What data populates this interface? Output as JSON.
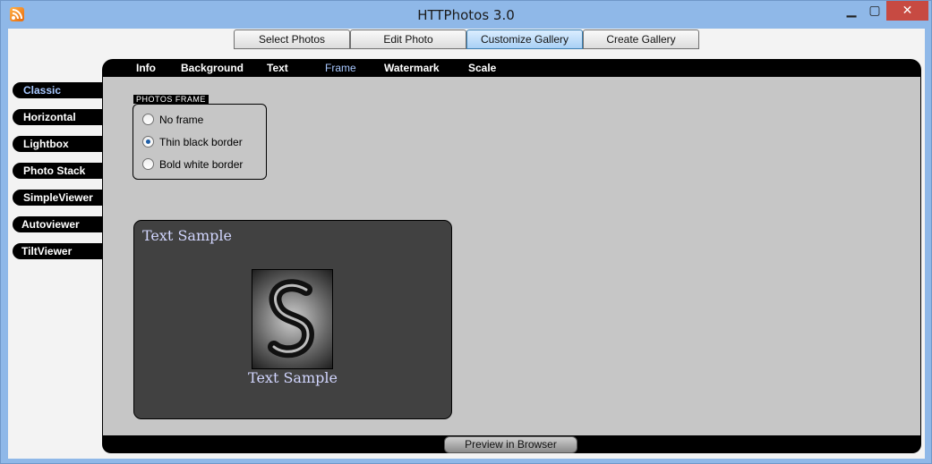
{
  "window": {
    "title": "HTTPhotos 3.0",
    "min_glyph": "▁",
    "max_glyph": "▢",
    "close_glyph": "✕"
  },
  "tabs": [
    "Select Photos",
    "Edit Photo",
    "Customize Gallery",
    "Create Gallery"
  ],
  "active_tab": "Customize Gallery",
  "subnav": [
    "Info",
    "Background",
    "Text",
    "Frame",
    "Watermark",
    "Scale"
  ],
  "active_subnav": "Frame",
  "sidebar": [
    "Classic",
    "Horizontal",
    "Lightbox",
    "Photo Stack",
    "SimpleViewer",
    "Autoviewer",
    "TiltViewer"
  ],
  "active_sidebar": "Classic",
  "frame": {
    "legend": "PHOTOS FRAME",
    "options": [
      "No frame",
      "Thin black border",
      "Bold white border"
    ],
    "selected": "Thin black border"
  },
  "preview": {
    "title": "Text Sample",
    "caption": "Text Sample"
  },
  "preview_button": "Preview in Browser",
  "colors": {
    "panel": "#000000",
    "content": "#c6c6c6",
    "preview_bg": "#414141",
    "sample_text": "#d2d6ff",
    "active_link": "#a8c8ff"
  }
}
